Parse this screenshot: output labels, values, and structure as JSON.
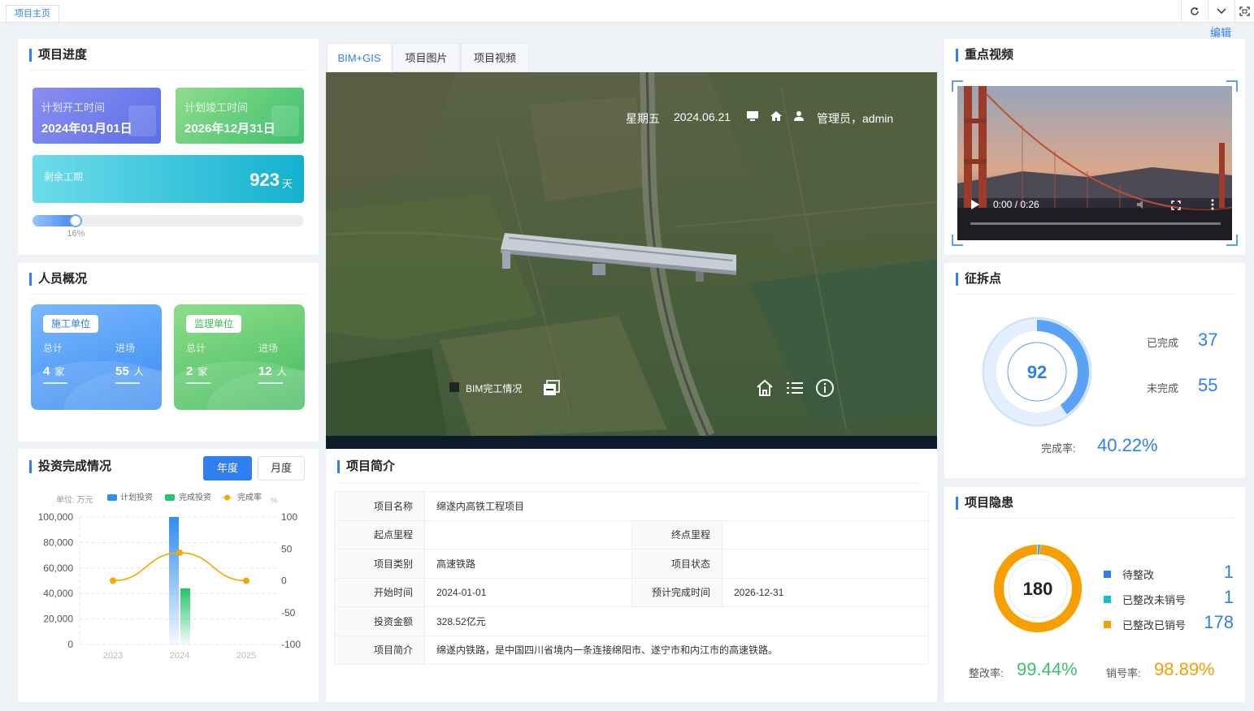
{
  "top": {
    "tab": "项目主页",
    "edit": "编辑"
  },
  "progress": {
    "title": "项目进度",
    "plan_start_label": "计划开工时间",
    "plan_start": "2024年01月01日",
    "plan_end_label": "计划竣工时间",
    "plan_end": "2026年12月31日",
    "remain_label": "剩余工期",
    "remain_days": "923",
    "remain_unit": "天",
    "percent_label": "16%",
    "percent": 0.16
  },
  "personnel": {
    "title": "人员概况",
    "construction": {
      "tag": "施工单位",
      "total_label": "总计",
      "enter_label": "进场",
      "total": "4",
      "total_unit": "家",
      "enter": "55",
      "enter_unit": "人"
    },
    "supervision": {
      "tag": "监理单位",
      "total_label": "总计",
      "enter_label": "进场",
      "total": "2",
      "total_unit": "家",
      "enter": "12",
      "enter_unit": "人"
    }
  },
  "investment": {
    "title": "投资完成情况",
    "btn_year": "年度",
    "btn_month": "月度",
    "unit": "单位: 万元",
    "legend": [
      "计划投资",
      "完成投资",
      "完成率"
    ],
    "right_unit": "%",
    "colors": {
      "plan": "#2f8cf0",
      "done": "#27c46b",
      "rate": "#f5a800"
    }
  },
  "chart_data": {
    "type": "bar",
    "categories": [
      "2023",
      "2024",
      "2025"
    ],
    "series": [
      {
        "name": "计划投资",
        "values": [
          0,
          100000,
          0
        ]
      },
      {
        "name": "完成投资",
        "values": [
          0,
          44000,
          0
        ]
      },
      {
        "name": "完成率",
        "values": [
          0,
          44,
          0
        ],
        "type": "line",
        "axis": "right"
      }
    ],
    "y_left_ticks": [
      "100,000",
      "80,000",
      "60,000",
      "40,000",
      "20,000",
      "0"
    ],
    "y_right_ticks": [
      "100",
      "50",
      "0",
      "-50",
      "-100"
    ],
    "ylim": [
      0,
      100000
    ],
    "y2lim": [
      -100,
      100
    ],
    "legend": "top",
    "grid": true
  },
  "center": {
    "tabs": [
      "BIM+GIS",
      "项目图片",
      "项目视频"
    ],
    "map_weekday": "星期五",
    "map_date": "2024.06.21",
    "map_user": "管理员，admin",
    "bim_label": "BIM完工情况"
  },
  "intro": {
    "title": "项目简介",
    "rows": {
      "name_k": "项目名称",
      "name_v": "绵遂内高铁工程项目",
      "start_k": "起点里程",
      "start_v": "",
      "end_k": "终点里程",
      "end_v": "",
      "type_k": "项目类别",
      "type_v": "高速铁路",
      "status_k": "项目状态",
      "status_v": "",
      "begin_k": "开始时间",
      "begin_v": "2024-01-01",
      "finish_k": "预计完成时间",
      "finish_v": "2026-12-31",
      "amount_k": "投资金额",
      "amount_v": "328.52亿元",
      "desc_k": "项目简介",
      "desc_v": "绵遂内铁路，是中国四川省境内一条连接绵阳市、遂宁市和内江市的高速铁路。"
    }
  },
  "video": {
    "title": "重点视频",
    "time": "0:00 / 0:26"
  },
  "demolition": {
    "title": "征拆点",
    "total": "92",
    "done_label": "已完成",
    "done": "37",
    "undone_label": "未完成",
    "undone": "55",
    "rate_label": "完成率:",
    "rate": "40.22%",
    "rate_value": 0.4022
  },
  "hazard": {
    "title": "项目隐患",
    "total": "180",
    "items": [
      {
        "label": "待整改",
        "value": "1",
        "color": "#2f7ff0"
      },
      {
        "label": "已整改未销号",
        "value": "1",
        "color": "#12c1cf"
      },
      {
        "label": "已整改已销号",
        "value": "178",
        "color": "#f5a000"
      }
    ],
    "fix_rate_label": "整改率:",
    "fix_rate": "99.44%",
    "close_rate_label": "销号率:",
    "close_rate": "98.89%"
  }
}
